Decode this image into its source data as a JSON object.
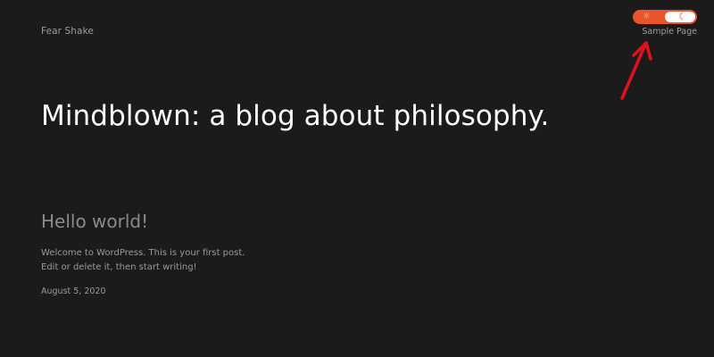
{
  "header": {
    "site_title": "Fear Shake",
    "nav": [
      {
        "label": "Sample Page"
      }
    ],
    "theme_toggle": {
      "active_mode": "dark",
      "sun_icon": "sun-icon",
      "moon_icon": "moon-icon",
      "sun_glyph": "☼",
      "moon_glyph": "☾",
      "accent_color": "#e8542b"
    }
  },
  "main": {
    "heading": "Mindblown: a blog about philosophy.",
    "posts": [
      {
        "title": "Hello world!",
        "excerpt": "Welcome to WordPress. This is your first post. Edit or delete it, then start writing!",
        "date": "August 5, 2020"
      }
    ]
  },
  "annotation": {
    "arrow_color": "#e0111a"
  },
  "colors": {
    "background": "#1c1b1c",
    "heading": "#ffffff",
    "muted_text": "#9d9d9d"
  }
}
